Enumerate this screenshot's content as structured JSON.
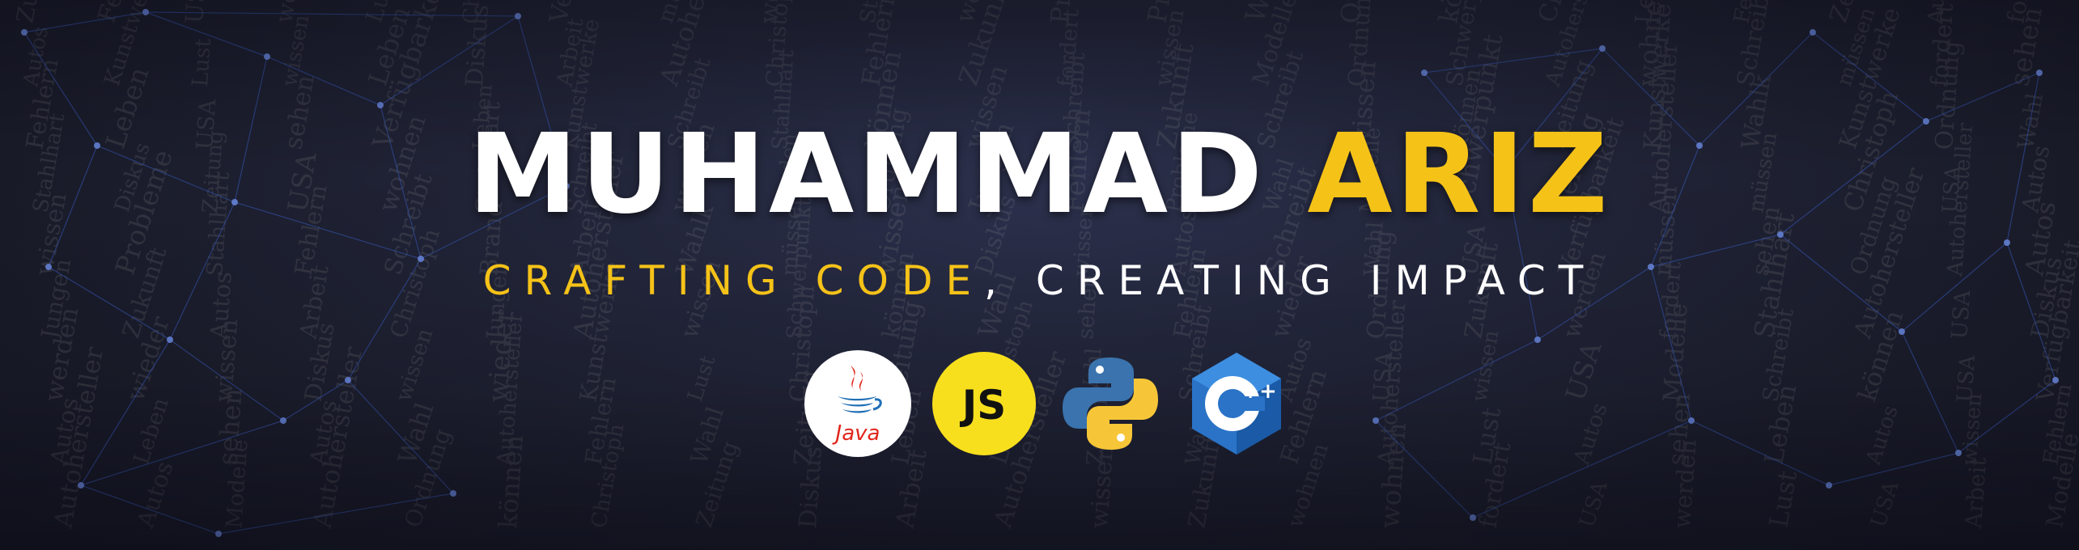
{
  "banner": {
    "name_first": "MUHAMMAD",
    "name_last": "ARIZ",
    "tagline_highlight": "CRAFTING CODE",
    "tagline_rest": ", CREATING IMPACT"
  },
  "icons": [
    {
      "name": "java-icon",
      "label": "Java"
    },
    {
      "name": "javascript-icon",
      "label": "JS"
    },
    {
      "name": "python-icon",
      "label": ""
    },
    {
      "name": "cpp-icon",
      "label": "C++"
    }
  ],
  "colors": {
    "accent": "#f5c218",
    "text": "#ffffff",
    "background": "#1c1e2c",
    "network_line": "#3a5dc4"
  },
  "background_newsprint": [
    "Schreibt",
    "Kunstwerke",
    "werden",
    "Wahlk",
    "Autohersteller",
    "Probleme",
    "Modelle",
    "Autos",
    "wieder",
    "müssen",
    "USA",
    "Christoph",
    "wissen",
    "Diskus",
    "Brand",
    "Fehlern",
    "fordert",
    "Zukunft",
    "Schwerpunkt",
    "wohnen",
    "sehen",
    "können",
    "Wahl",
    "Lust",
    "Jungen",
    "Arbeit",
    "Verfügbarkeit",
    "Stahlhart",
    "Zeitung",
    "Ordnung",
    "Leben"
  ]
}
